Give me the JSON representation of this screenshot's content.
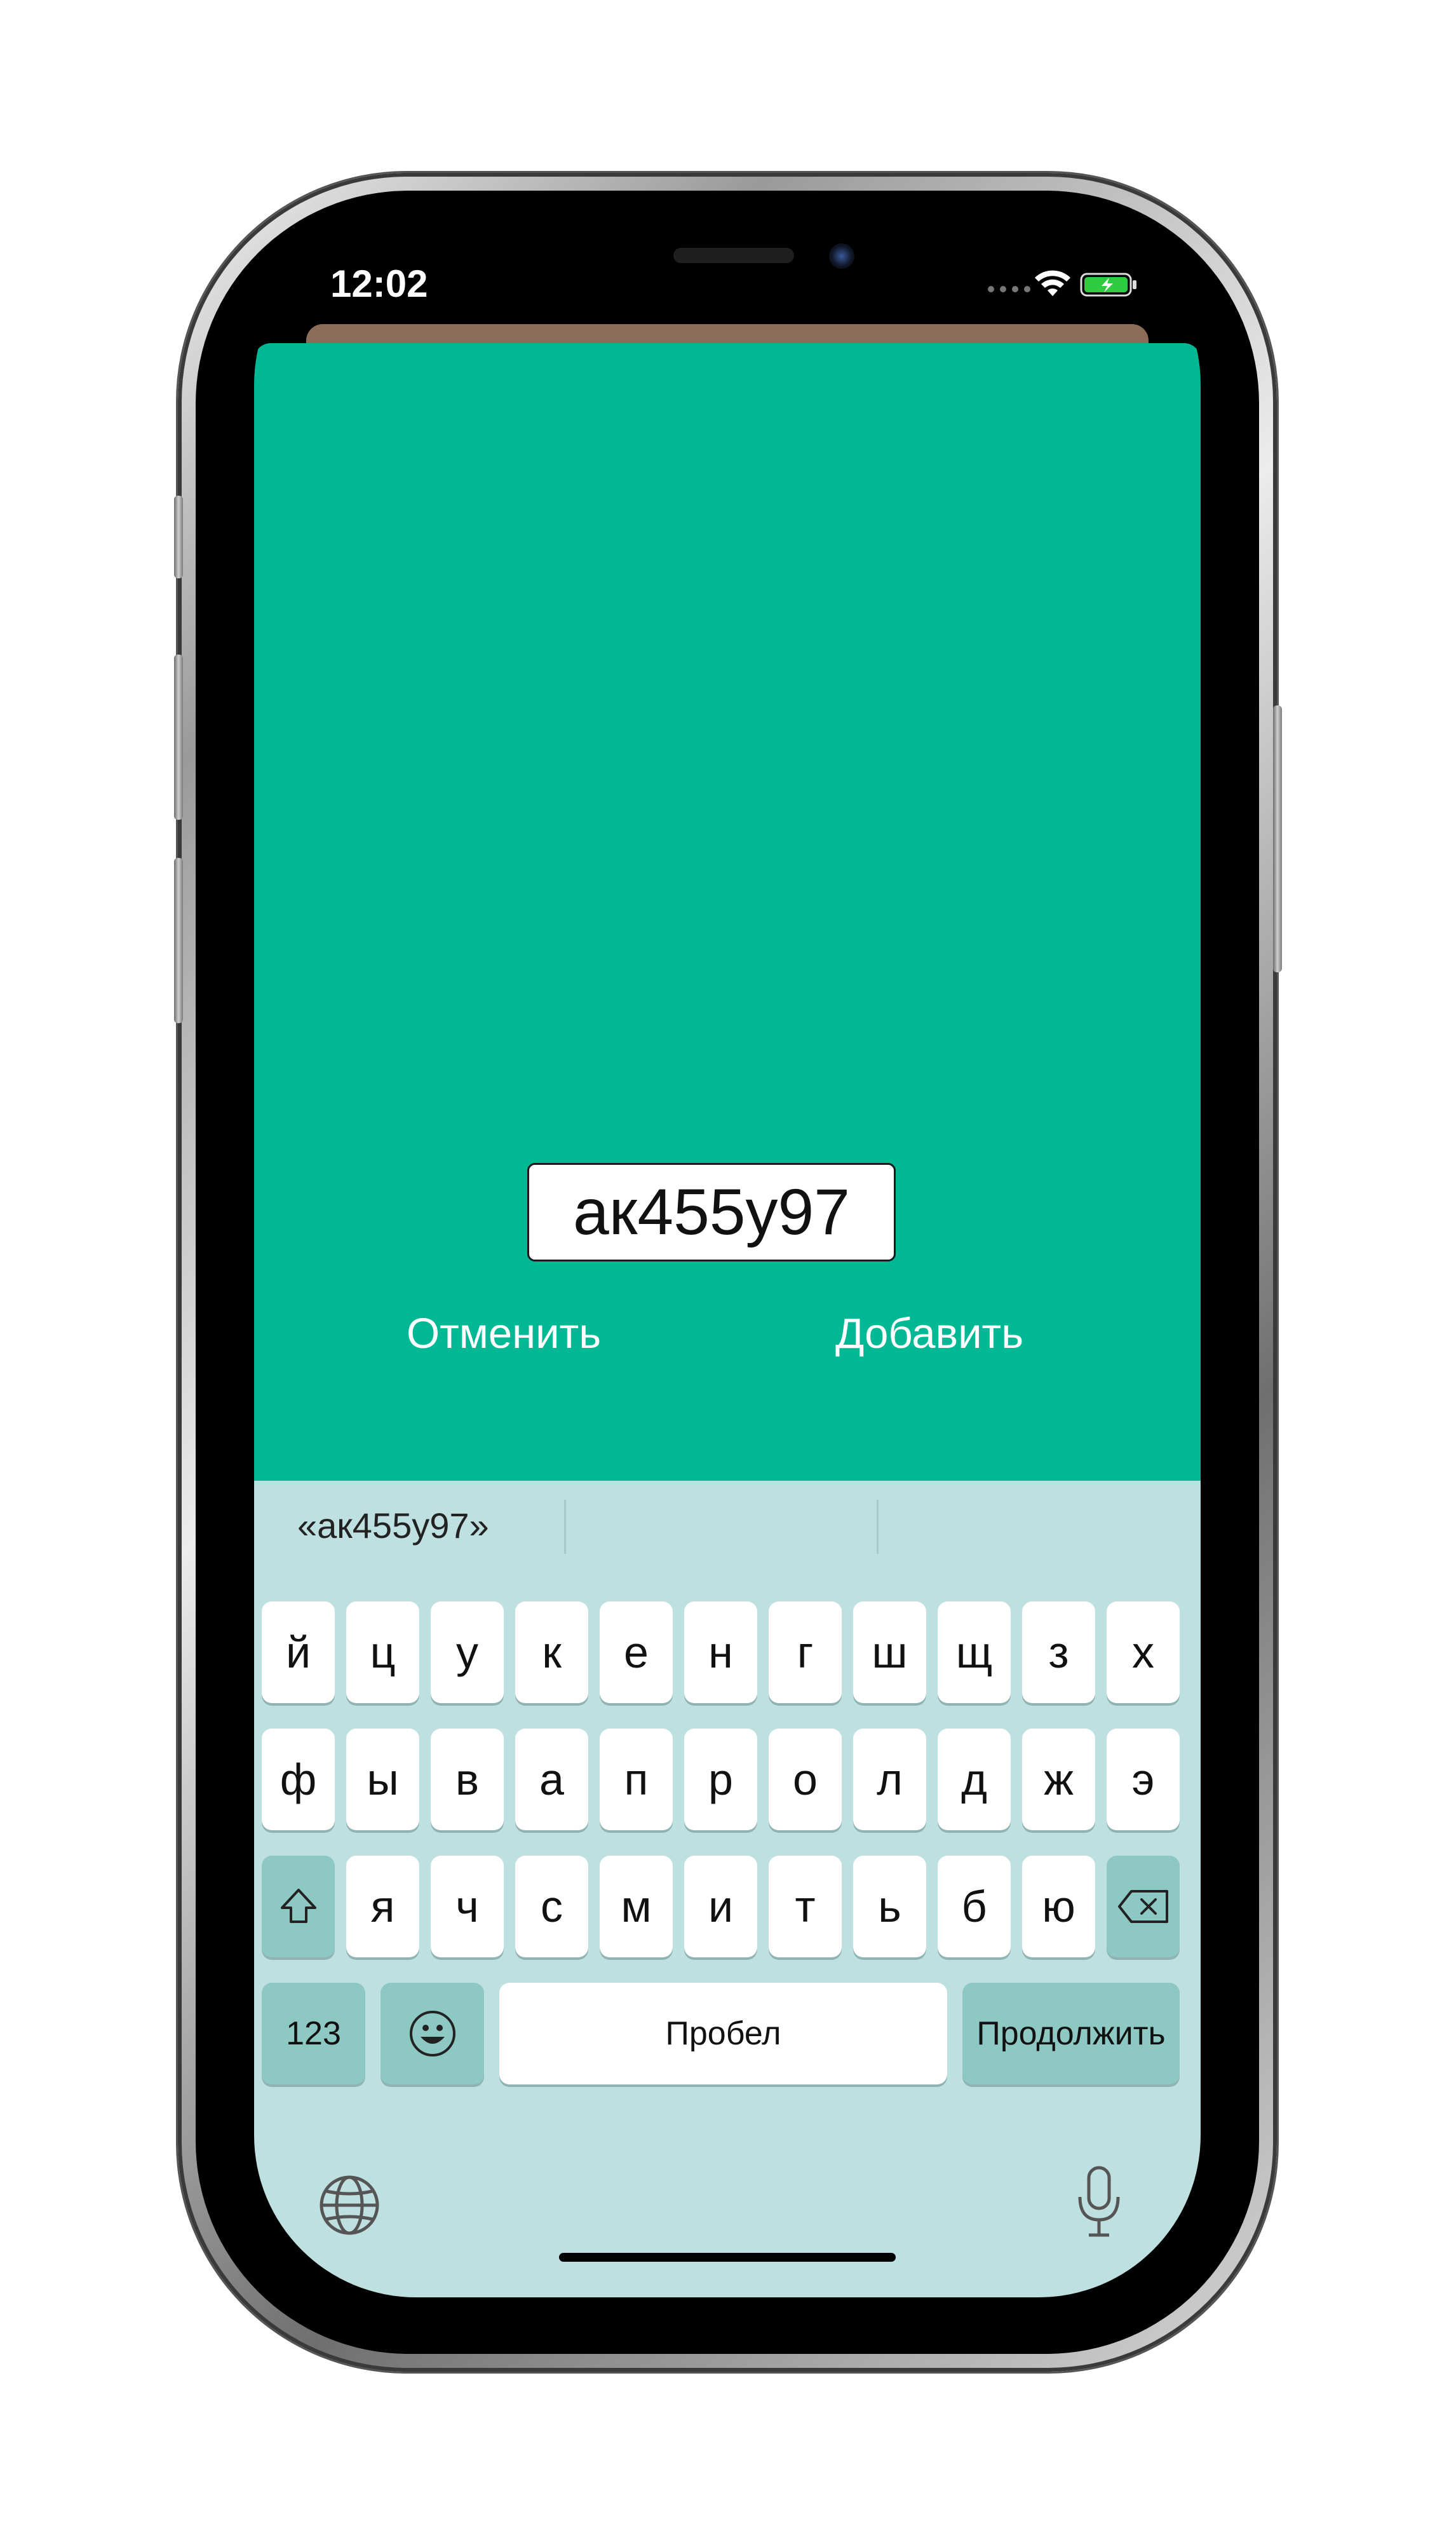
{
  "status_bar": {
    "time": "12:02"
  },
  "dialog": {
    "plate_value": "ак455у97",
    "cancel_label": "Отменить",
    "add_label": "Добавить"
  },
  "keyboard": {
    "suggestion": "«ак455у97»",
    "row1": [
      "й",
      "ц",
      "у",
      "к",
      "е",
      "н",
      "г",
      "ш",
      "щ",
      "з",
      "х"
    ],
    "row2": [
      "ф",
      "ы",
      "в",
      "а",
      "п",
      "р",
      "о",
      "л",
      "д",
      "ж",
      "э"
    ],
    "row3": [
      "я",
      "ч",
      "с",
      "м",
      "и",
      "т",
      "ь",
      "б",
      "ю"
    ],
    "numbers_label": "123",
    "space_label": "Пробел",
    "continue_label": "Продолжить"
  },
  "colors": {
    "dialog_bg": "#00b894",
    "keyboard_bg": "#bfe0e0",
    "function_key": "#8ec8c3"
  },
  "icons": [
    "shift-icon",
    "backspace-icon",
    "emoji-icon",
    "globe-icon",
    "microphone-icon",
    "wifi-icon",
    "battery-charging-icon"
  ]
}
